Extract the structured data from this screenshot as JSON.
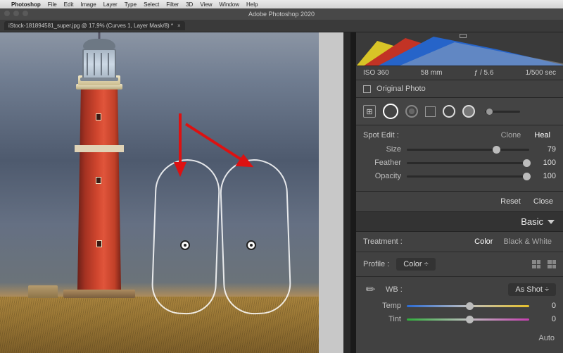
{
  "menubar": {
    "app": "Photoshop",
    "items": [
      "File",
      "Edit",
      "Image",
      "Layer",
      "Type",
      "Select",
      "Filter",
      "3D",
      "View",
      "Window",
      "Help"
    ]
  },
  "titlebar": {
    "title": "Adobe Photoshop 2020"
  },
  "tab": {
    "label": "iStock-181894581_super.jpg @ 17,9% (Curves 1, Layer Mask/8) *",
    "close": "×"
  },
  "meta": {
    "iso": "ISO 360",
    "focal": "58 mm",
    "aperture": "ƒ / 5.6",
    "shutter": "1/500 sec"
  },
  "original_photo": {
    "label": "Original Photo"
  },
  "spot": {
    "title": "Spot Edit :",
    "clone": "Clone",
    "heal": "Heal",
    "size_label": "Size",
    "size_val": "79",
    "feather_label": "Feather",
    "feather_val": "100",
    "opacity_label": "Opacity",
    "opacity_val": "100",
    "reset": "Reset",
    "close": "Close"
  },
  "basic": {
    "header": "Basic",
    "treatment_label": "Treatment :",
    "color": "Color",
    "bw": "Black & White",
    "profile_label": "Profile :",
    "profile_value": "Color ÷",
    "wb_label": "WB :",
    "wb_value": "As Shot ÷",
    "temp_label": "Temp",
    "temp_val": "0",
    "tint_label": "Tint",
    "tint_val": "0",
    "auto": "Auto"
  }
}
